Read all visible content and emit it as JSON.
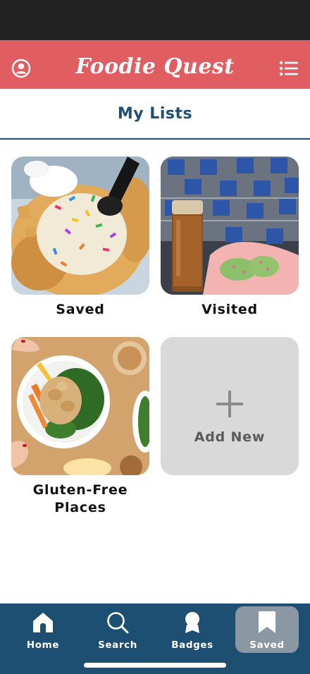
{
  "header": {
    "app_title": "Foodie Quest",
    "profile_icon": "profile-circle-icon",
    "menu_icon": "list-menu-icon",
    "background_color": "#e05d62"
  },
  "page": {
    "title": "My Lists",
    "title_color": "#1e4f73"
  },
  "lists": [
    {
      "label": "Saved",
      "image": "waffle-sundae-photo"
    },
    {
      "label": "Visited",
      "image": "iced-drink-and-cookies-photo"
    },
    {
      "label": "Gluten-Free Places",
      "image": "chicken-salad-bowl-photo"
    }
  ],
  "add_new": {
    "label": "Add New",
    "icon": "plus-icon"
  },
  "bottom_nav": {
    "background_color": "#1d4f73",
    "items": [
      {
        "label": "Home",
        "icon": "home-icon",
        "active": false
      },
      {
        "label": "Search",
        "icon": "search-icon",
        "active": false
      },
      {
        "label": "Badges",
        "icon": "badge-icon",
        "active": false
      },
      {
        "label": "Saved",
        "icon": "bookmark-icon",
        "active": true
      }
    ]
  }
}
